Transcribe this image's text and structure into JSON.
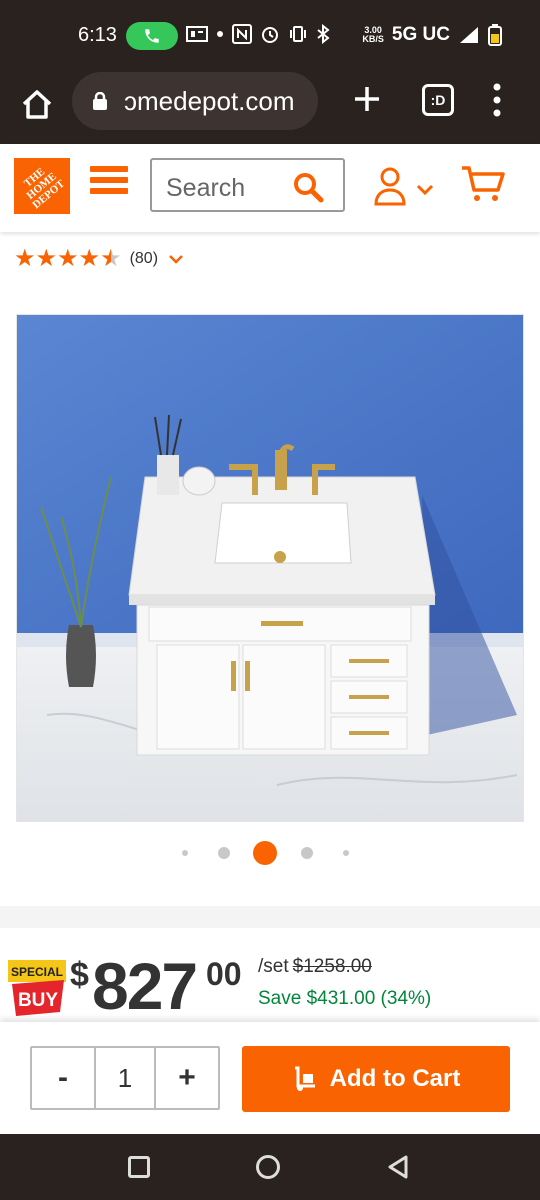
{
  "status_bar": {
    "time": "6:13",
    "net_speed_value": "3.00",
    "net_speed_unit": "KB/S",
    "network": "5G UC"
  },
  "browser": {
    "url": "ɔmedepot.com",
    "tabs_label": ":D"
  },
  "header": {
    "logo_text": "THE HOME DEPOT",
    "search_placeholder": "Search"
  },
  "product": {
    "rating": 4.5,
    "rating_count": "(80)"
  },
  "carousel": {
    "count": 5,
    "active_index": 2
  },
  "price": {
    "badge_line1": "SPECIAL",
    "badge_line2": "BUY",
    "currency": "$",
    "dollars": "827",
    "cents": "00",
    "unit": "/set",
    "original": "$1258.00",
    "savings": "Save $431.00 (34%)"
  },
  "cart": {
    "minus": "-",
    "quantity": "1",
    "plus": "+",
    "add_label": "Add to Cart"
  },
  "colors": {
    "brand": "#f96302",
    "savings": "#00873c",
    "dark_chrome": "#2a221f"
  }
}
